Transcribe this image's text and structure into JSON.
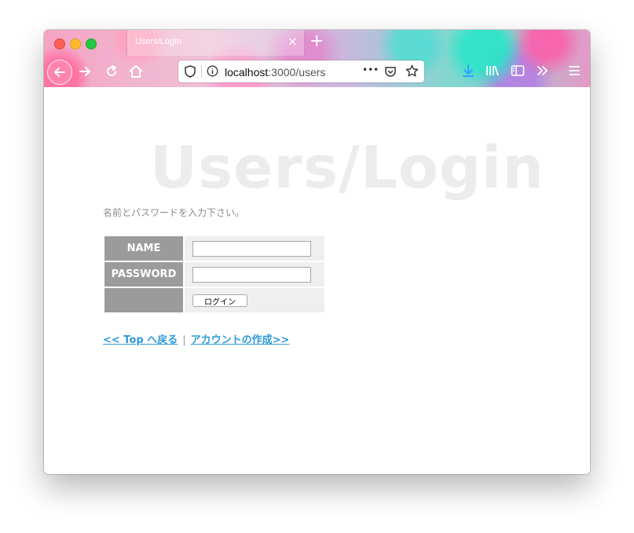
{
  "window": {
    "tab_title": "Users/Login",
    "tab_close": "×",
    "new_tab": "+"
  },
  "toolbar": {
    "url_host": "localhost",
    "url_rest": ":3000/users",
    "more": "•••",
    "icons": [
      "back-arrow-icon",
      "forward-arrow-icon",
      "reload-icon",
      "home-icon",
      "shield-icon",
      "info-icon",
      "pocket-icon",
      "star-icon",
      "download-icon",
      "library-icon",
      "sidebar-icon",
      "overflow-icon",
      "menu-icon"
    ]
  },
  "page": {
    "heading": "Users/Login",
    "instruction": "名前とパスワードを入力下さい。",
    "form": {
      "name_label": "NAME",
      "name_value": "",
      "password_label": "PASSWORD",
      "password_value": "",
      "submit_label": "ログイン"
    },
    "links": {
      "back": "<< Top へ戻る",
      "separator": "|",
      "create": "アカウントの作成>>"
    }
  },
  "colors": {
    "link": "#2f9ad8",
    "label_bg": "#9b9b9b",
    "field_bg": "#efefef",
    "heading": "#ececec"
  }
}
